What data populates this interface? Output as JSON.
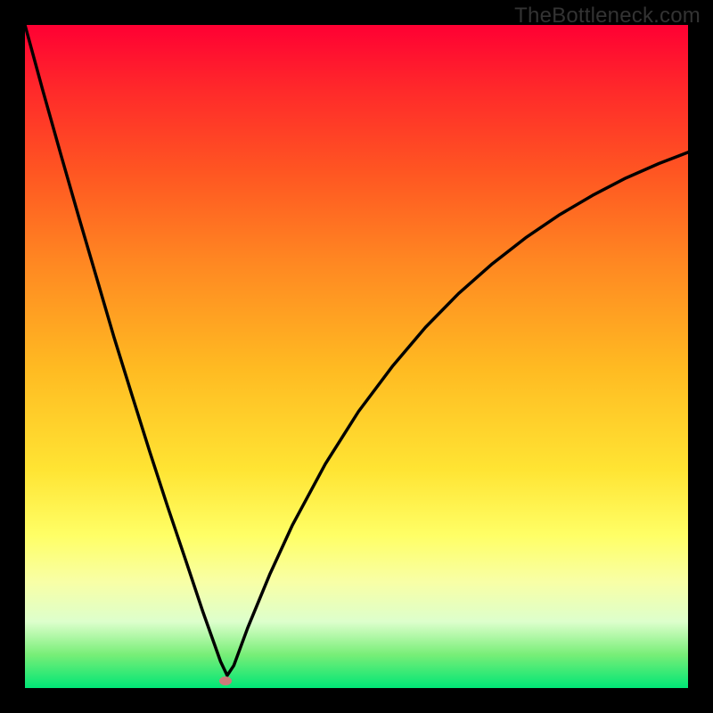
{
  "watermark": {
    "text": "TheBottleneck.com"
  },
  "chart_data": {
    "type": "line",
    "title": "",
    "xlabel": "",
    "ylabel": "",
    "xlim": [
      0,
      100
    ],
    "ylim": [
      0,
      100
    ],
    "grid": false,
    "legend": false,
    "background_gradient": {
      "direction": "vertical",
      "stops": [
        {
          "pos": 0,
          "color": "#ff0033"
        },
        {
          "pos": 50,
          "color": "#ffcc22"
        },
        {
          "pos": 80,
          "color": "#ffff66"
        },
        {
          "pos": 100,
          "color": "#00e676"
        }
      ]
    },
    "series": [
      {
        "name": "bottleneck-curve",
        "color": "#000000",
        "x": [
          0,
          2.7,
          5.4,
          8.1,
          10.8,
          13.4,
          16.1,
          18.8,
          21.5,
          24.2,
          26.8,
          29.5,
          30.5,
          31.5,
          33.6,
          36.9,
          40.3,
          45.3,
          50.3,
          55.4,
          60.4,
          65.4,
          70.5,
          75.5,
          80.5,
          85.6,
          90.6,
          95.6,
          100
        ],
        "values": [
          100,
          90.1,
          80.5,
          71.1,
          61.9,
          53.0,
          44.3,
          35.7,
          27.4,
          19.4,
          11.6,
          4.0,
          1.9,
          3.4,
          9.1,
          17.1,
          24.5,
          33.8,
          41.7,
          48.5,
          54.4,
          59.5,
          64.0,
          67.9,
          71.3,
          74.3,
          76.9,
          79.1,
          80.8
        ]
      }
    ],
    "marker": {
      "x": 30.2,
      "y": 1.1,
      "color": "#cc7a7a"
    }
  }
}
